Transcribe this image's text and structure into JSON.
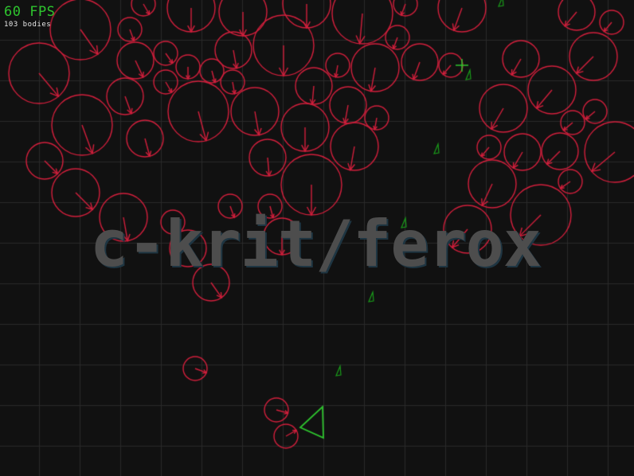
{
  "hud": {
    "fps_text": "60 FPS",
    "bodies_text": "103 bodies"
  },
  "watermark": "c-krit/ferox",
  "colors": {
    "background": "#111111",
    "grid": "#2a2a2a",
    "asteroid": "#d21f3c",
    "ship": "#2ec42e",
    "bullet": "#1a9e1a",
    "crosshair": "#2ec42e",
    "watermark": "#4d4d4d",
    "fps": "#2ec42e",
    "bodies_label": "#e8e8e8"
  },
  "icons": {
    "player": "triangle-ship-icon",
    "cursor": "crosshair-icon",
    "asteroid": "circle-body-icon",
    "bullet": "bullet-icon"
  }
}
